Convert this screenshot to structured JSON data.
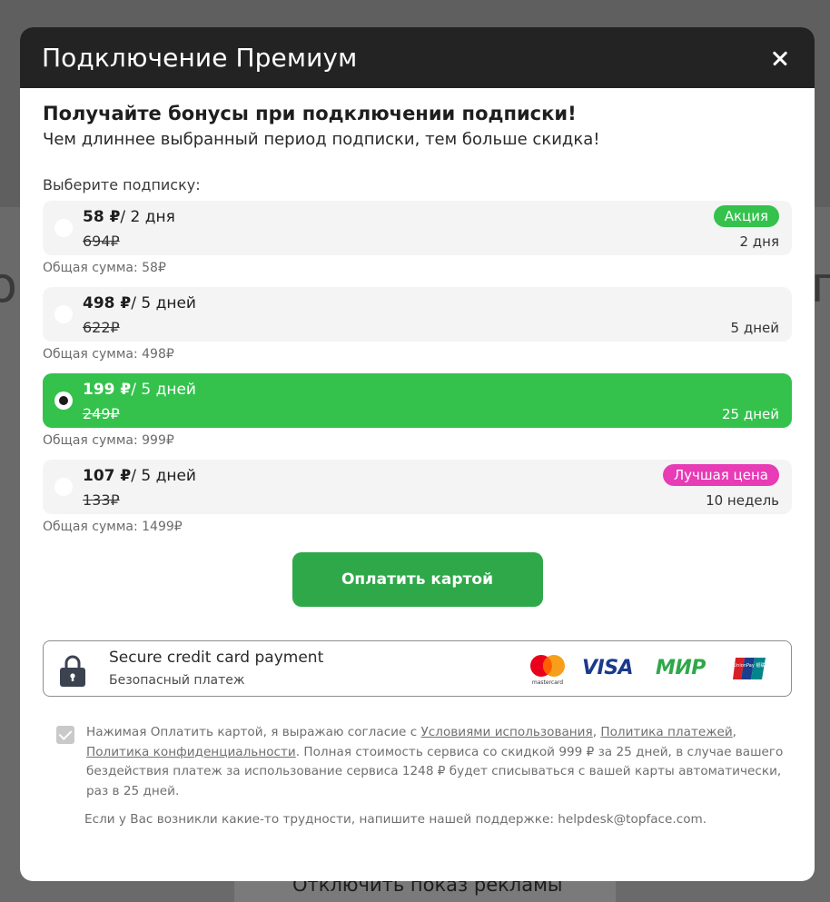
{
  "background": {
    "left_glyph": "о",
    "right_glyph": "п",
    "bottom_button": "Отключить показ рекламы"
  },
  "modal": {
    "title": "Подключение Премиум",
    "headline": "Получайте бонусы при подключении подписки!",
    "subline": "Чем длиннее выбранный период подписки, тем больше скидка!",
    "choose_label": "Выберите подписку:"
  },
  "plans": [
    {
      "price": "58 ₽",
      "per": "/ 2 дня",
      "old_price": "694₽",
      "badge": "Акция",
      "period": "2 дня",
      "total": "Общая сумма: 58₽",
      "selected": false
    },
    {
      "price": "498 ₽",
      "per": "/ 5 дней",
      "old_price": "622₽",
      "badge": "",
      "period": "5 дней",
      "total": "Общая сумма: 498₽",
      "selected": false
    },
    {
      "price": "199 ₽",
      "per": "/ 5 дней",
      "old_price": "249₽",
      "badge": "",
      "period": "25 дней",
      "total": "Общая сумма: 999₽",
      "selected": true
    },
    {
      "price": "107 ₽",
      "per": "/ 5 дней",
      "old_price": "133₽",
      "badge": "Лучшая цена",
      "period": "10 недель",
      "total": "Общая сумма: 1499₽",
      "selected": false
    }
  ],
  "pay_button": "Оплатить картой",
  "secure": {
    "title": "Secure credit card payment",
    "subtitle": "Безопасный платеж",
    "mastercard_label": "mastercard",
    "visa": "VISA",
    "mir": "МИР",
    "unionpay": "UnionPay 银联"
  },
  "consent": {
    "checked": true,
    "text_prefix": "Нажимая Оплатить картой, я выражаю согласие с ",
    "link_terms": "Условиями использования",
    "sep1": ", ",
    "link_payments": "Политика платежей",
    "sep2": ", ",
    "link_privacy": "Политика конфиденциальности",
    "text_suffix": ".  Полная стоимость сервиса со скидкой 999 ₽ за 25 дней, в случае вашего бездействия платеж за использование сервиса 1248 ₽ будет списываться с вашей карты автоматически, раз в 25 дней."
  },
  "support": "Если у Вас возникли какие-то трудности, напишите нашей поддержке: helpdesk@topface.com.",
  "colors": {
    "accent_green": "#34c24d",
    "pay_green": "#2fa84a",
    "badge_pink": "#e83bb6",
    "header_dark": "#232323",
    "visa_blue": "#1a3a8c"
  }
}
